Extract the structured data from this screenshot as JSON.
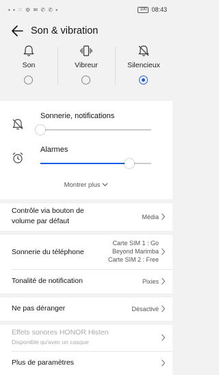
{
  "status": {
    "left_icons": "▪ ▪ ⁙ ⚙ ✉ ✆ ✆ ▪",
    "battery": "100",
    "time": "08:43"
  },
  "header": {
    "title": "Son & vibration"
  },
  "modes": [
    {
      "label": "Son",
      "selected": false
    },
    {
      "label": "Vibreur",
      "selected": false
    },
    {
      "label": "Silencieux",
      "selected": true
    }
  ],
  "volume": {
    "ringtone_label": "Sonnerie, notifications",
    "ringtone_level": 0.0,
    "alarm_label": "Alarmes",
    "alarm_level": 0.8,
    "more_label": "Montrer plus"
  },
  "settings": {
    "volume_button": {
      "label": "Contrôle via bouton de volume par défaut",
      "value": "Média"
    },
    "phone_ringtone": {
      "label": "Sonnerie du téléphone",
      "value_line1": "Carte SIM 1 : Go",
      "value_line2": "Beyond Marimba",
      "value_line3": "Carte SIM 2 : Free"
    },
    "notification_tone": {
      "label": "Tonalité de notification",
      "value": "Pixies"
    },
    "dnd": {
      "label": "Ne pas déranger",
      "value": "Désactivé"
    },
    "histen": {
      "label": "Effets sonores HONOR Histen",
      "sublabel": "Disponible qu'avec un casque"
    },
    "more_settings": {
      "label": "Plus de paramètres"
    }
  },
  "colors": {
    "accent": "#1a5ee6",
    "background": "#f2f2f2"
  }
}
